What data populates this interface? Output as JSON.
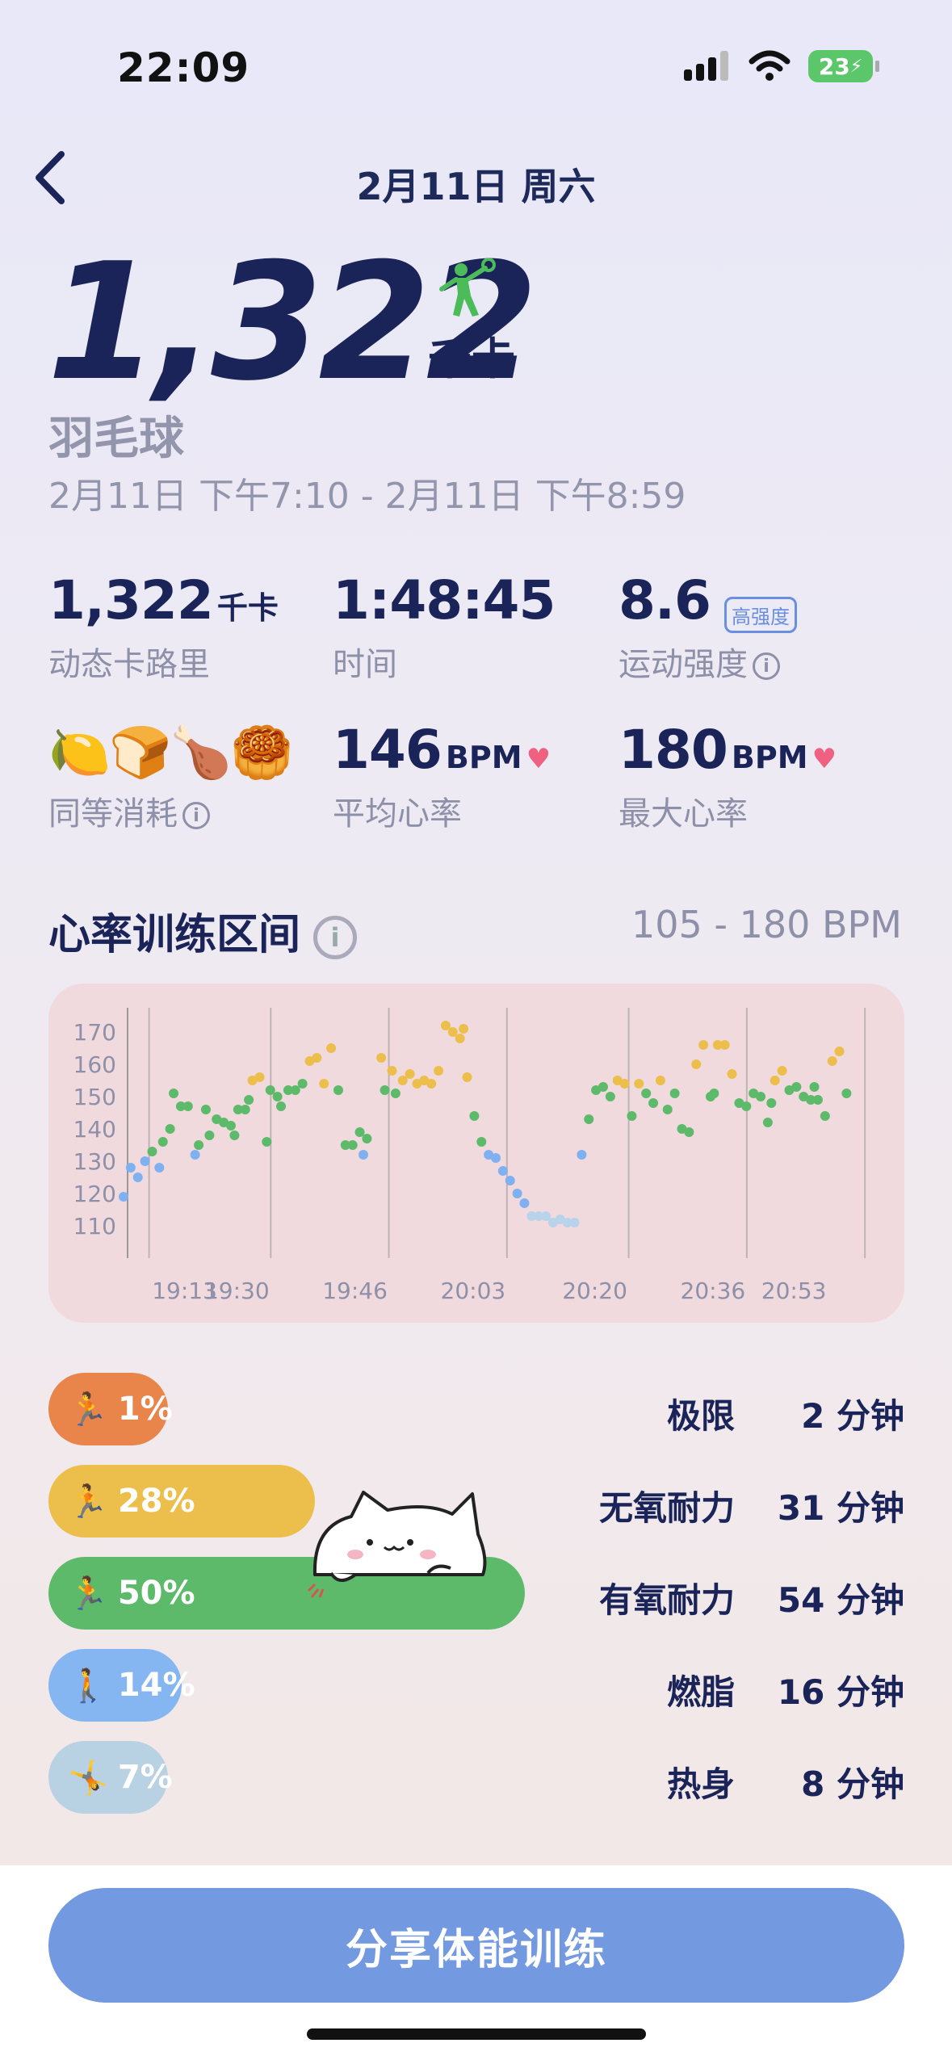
{
  "status_bar": {
    "time": "22:09",
    "battery": "23"
  },
  "header": {
    "date": "2月11日 周六"
  },
  "summary": {
    "calories": "1,322",
    "calories_unit": "千卡",
    "sport_icon": "badminton-player-icon",
    "sport": "羽毛球",
    "time_range": "2月11日 下午7:10 - 2月11日 下午8:59"
  },
  "stats": {
    "active_cal_value": "1,322",
    "active_cal_unit": "千卡",
    "active_cal_label": "动态卡路里",
    "duration_value": "1:48:45",
    "duration_label": "时间",
    "intensity_value": "8.6",
    "intensity_badge": "高强度",
    "intensity_label": "运动强度",
    "equivalent_label": "同等消耗",
    "equivalent_items": [
      "🍋",
      "🍞",
      "🍗",
      "🥮"
    ],
    "avg_hr_value": "146",
    "avg_hr_unit": "BPM",
    "avg_hr_label": "平均心率",
    "max_hr_value": "180",
    "max_hr_unit": "BPM",
    "max_hr_label": "最大心率"
  },
  "zones_section": {
    "title": "心率训练区间",
    "range": "105 - 180 BPM"
  },
  "chart_data": {
    "type": "scatter",
    "x_ticks": [
      "19:13",
      "19:30",
      "19:46",
      "20:03",
      "20:20",
      "20:36",
      "20:53"
    ],
    "y_ticks": [
      170,
      160,
      150,
      140,
      130,
      120,
      110
    ],
    "ylim": [
      105,
      175
    ],
    "xlim_minutes": [
      0,
      104
    ],
    "grid": "vertical lines at x ticks",
    "points": [
      [
        0,
        119,
        "blue"
      ],
      [
        1,
        128,
        "blue"
      ],
      [
        2,
        125,
        "blue"
      ],
      [
        3,
        130,
        "blue"
      ],
      [
        4,
        133,
        "green"
      ],
      [
        5,
        128,
        "blue"
      ],
      [
        5.5,
        136,
        "green"
      ],
      [
        6.5,
        140,
        "green"
      ],
      [
        7,
        151,
        "green"
      ],
      [
        8,
        147,
        "green"
      ],
      [
        9,
        147,
        "green"
      ],
      [
        10,
        132,
        "blue"
      ],
      [
        10.5,
        135,
        "green"
      ],
      [
        11.5,
        146,
        "green"
      ],
      [
        12,
        138,
        "green"
      ],
      [
        13,
        143,
        "green"
      ],
      [
        14,
        142,
        "green"
      ],
      [
        15,
        141,
        "green"
      ],
      [
        15.5,
        138,
        "green"
      ],
      [
        16,
        146,
        "green"
      ],
      [
        17,
        146,
        "green"
      ],
      [
        17.5,
        149,
        "green"
      ],
      [
        18,
        155,
        "yellow"
      ],
      [
        19,
        156,
        "yellow"
      ],
      [
        20,
        136,
        "green"
      ],
      [
        20.5,
        152,
        "green"
      ],
      [
        21.5,
        150,
        "green"
      ],
      [
        22,
        147,
        "green"
      ],
      [
        23,
        152,
        "green"
      ],
      [
        24,
        152,
        "green"
      ],
      [
        25,
        154,
        "green"
      ],
      [
        26,
        161,
        "yellow"
      ],
      [
        27,
        162,
        "yellow"
      ],
      [
        28,
        154,
        "yellow"
      ],
      [
        29,
        165,
        "yellow"
      ],
      [
        30,
        152,
        "green"
      ],
      [
        31,
        135,
        "green"
      ],
      [
        32,
        135,
        "green"
      ],
      [
        33,
        139,
        "green"
      ],
      [
        33.5,
        132,
        "blue"
      ],
      [
        34,
        137,
        "green"
      ],
      [
        36,
        162,
        "yellow"
      ],
      [
        36.5,
        152,
        "green"
      ],
      [
        37.5,
        158,
        "yellow"
      ],
      [
        38,
        151,
        "green"
      ],
      [
        39,
        155,
        "yellow"
      ],
      [
        40,
        157,
        "yellow"
      ],
      [
        41,
        154,
        "yellow"
      ],
      [
        42,
        155,
        "yellow"
      ],
      [
        43,
        154,
        "yellow"
      ],
      [
        44,
        158,
        "yellow"
      ],
      [
        45,
        172,
        "yellow"
      ],
      [
        46,
        170,
        "yellow"
      ],
      [
        47,
        168,
        "yellow"
      ],
      [
        47.5,
        171,
        "yellow"
      ],
      [
        48,
        156,
        "yellow"
      ],
      [
        49,
        144,
        "green"
      ],
      [
        50,
        136,
        "green"
      ],
      [
        51,
        132,
        "blue"
      ],
      [
        52,
        131,
        "blue"
      ],
      [
        53,
        127,
        "blue"
      ],
      [
        54,
        124,
        "blue"
      ],
      [
        55,
        120,
        "blue"
      ],
      [
        56,
        117,
        "blue"
      ],
      [
        57,
        113,
        "light-blue"
      ],
      [
        58,
        113,
        "light-blue"
      ],
      [
        59,
        113,
        "light-blue"
      ],
      [
        60,
        111,
        "light-blue"
      ],
      [
        61,
        112,
        "light-blue"
      ],
      [
        62,
        111,
        "light-blue"
      ],
      [
        63,
        111,
        "light-blue"
      ],
      [
        64,
        132,
        "blue"
      ],
      [
        65,
        143,
        "green"
      ],
      [
        66,
        152,
        "green"
      ],
      [
        67,
        153,
        "green"
      ],
      [
        68,
        150,
        "green"
      ],
      [
        69,
        155,
        "yellow"
      ],
      [
        70,
        154,
        "yellow"
      ],
      [
        71,
        144,
        "green"
      ],
      [
        72,
        154,
        "yellow"
      ],
      [
        73,
        151,
        "green"
      ],
      [
        74,
        148,
        "green"
      ],
      [
        75,
        155,
        "yellow"
      ],
      [
        76,
        146,
        "green"
      ],
      [
        77,
        151,
        "green"
      ],
      [
        78,
        140,
        "green"
      ],
      [
        79,
        139,
        "green"
      ],
      [
        80,
        160,
        "yellow"
      ],
      [
        81,
        166,
        "yellow"
      ],
      [
        82,
        150,
        "green"
      ],
      [
        82.5,
        151,
        "green"
      ],
      [
        83,
        166,
        "yellow"
      ],
      [
        84,
        166,
        "yellow"
      ],
      [
        85,
        157,
        "yellow"
      ],
      [
        86,
        148,
        "green"
      ],
      [
        87,
        147,
        "green"
      ],
      [
        88,
        151,
        "green"
      ],
      [
        89,
        150,
        "green"
      ],
      [
        90,
        142,
        "green"
      ],
      [
        90.5,
        148,
        "green"
      ],
      [
        91,
        155,
        "yellow"
      ],
      [
        92,
        158,
        "yellow"
      ],
      [
        93,
        152,
        "green"
      ],
      [
        94,
        153,
        "green"
      ],
      [
        95,
        150,
        "green"
      ],
      [
        96,
        149,
        "green"
      ],
      [
        96.5,
        153,
        "green"
      ],
      [
        97,
        149,
        "green"
      ],
      [
        98,
        144,
        "green"
      ],
      [
        99,
        161,
        "yellow"
      ],
      [
        100,
        164,
        "yellow"
      ],
      [
        101,
        151,
        "green"
      ]
    ]
  },
  "zone_colors": {
    "limit": "#e9844a",
    "anaerobic": "#ecbf4c",
    "aerobic": "#5dba6a",
    "fat_burn": "#86b6f2",
    "warm_up": "#b8d1e3"
  },
  "zones": [
    {
      "percent": "1%",
      "pct_value": 0.01,
      "name": "极限",
      "minutes": "2 分钟",
      "key": "limit"
    },
    {
      "percent": "28%",
      "pct_value": 0.28,
      "name": "无氧耐力",
      "minutes": "31 分钟",
      "key": "anaerobic"
    },
    {
      "percent": "50%",
      "pct_value": 0.5,
      "name": "有氧耐力",
      "minutes": "54 分钟",
      "key": "aerobic"
    },
    {
      "percent": "14%",
      "pct_value": 0.14,
      "name": "燃脂",
      "minutes": "16 分钟",
      "key": "fat_burn"
    },
    {
      "percent": "7%",
      "pct_value": 0.07,
      "name": "热身",
      "minutes": "8 分钟",
      "key": "warm_up"
    }
  ],
  "share_button": "分享体能训练"
}
